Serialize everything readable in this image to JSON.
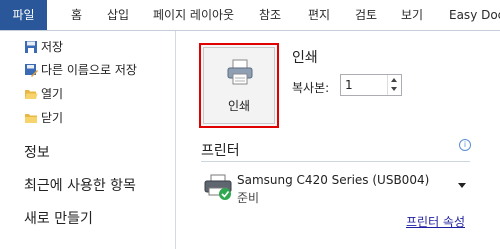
{
  "ribbon": {
    "tabs": [
      "파일",
      "홈",
      "삽입",
      "페이지 레이아웃",
      "참조",
      "편지",
      "검토",
      "보기",
      "Easy Docu"
    ]
  },
  "left_menu": {
    "items": [
      {
        "label": "저장",
        "icon": "save-icon"
      },
      {
        "label": "다른 이름으로 저장",
        "icon": "save-as-icon"
      },
      {
        "label": "열기",
        "icon": "open-folder-icon"
      },
      {
        "label": "닫기",
        "icon": "close-folder-icon"
      }
    ],
    "sections": [
      "정보",
      "최근에 사용한 항목",
      "새로 만들기"
    ]
  },
  "print_panel": {
    "print_button_label": "인쇄",
    "heading": "인쇄",
    "copies_label": "복사본:",
    "copies_value": "1",
    "printer_heading": "프린터",
    "printer_name": "Samsung C420 Series (USB004)",
    "printer_status": "준비",
    "printer_properties_link": "프린터 속성"
  },
  "colors": {
    "file_tab": "#2a579a",
    "highlight_border": "#e00000"
  }
}
